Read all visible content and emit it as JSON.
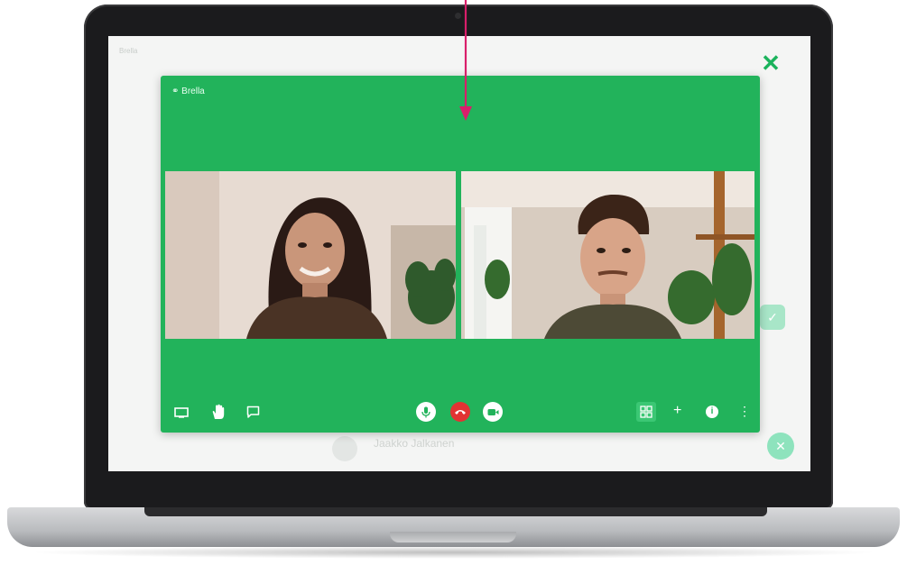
{
  "app": {
    "brand": "Brella"
  },
  "background_page": {
    "logo_text": "Brella",
    "title_text": "",
    "user_text": "",
    "person_name": "Jaakko Jalkanen",
    "person_role": "",
    "icons": [
      "check-icon",
      "close-icon"
    ]
  },
  "call": {
    "logo_text": "Brella",
    "participants": [
      {
        "video": "woman-smiling"
      },
      {
        "video": "man-with-plant-background"
      }
    ],
    "left_controls": [
      "screen-share-icon",
      "raise-hand-icon",
      "chat-icon"
    ],
    "center_controls": [
      "microphone-icon",
      "end-call-icon",
      "camera-icon"
    ],
    "right_controls": [
      "grid-view-icon",
      "add-icon",
      "info-icon",
      "more-icon"
    ],
    "labels": {
      "add": "+",
      "info": "i",
      "more": "⋮"
    }
  },
  "colors": {
    "call_green": "#22b35b",
    "end_call_red": "#e23333",
    "annotation_arrow": "#d91f6b",
    "close_green": "#1bb35c"
  }
}
